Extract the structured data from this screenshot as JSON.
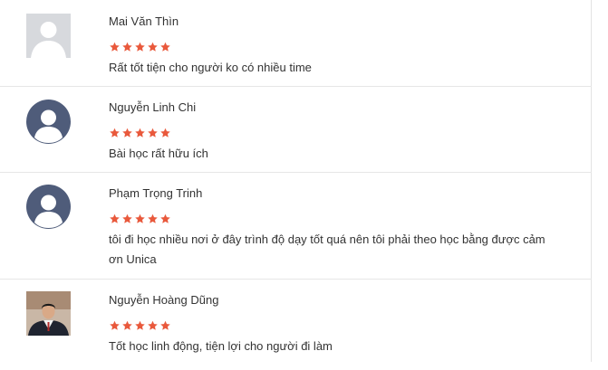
{
  "accent_star_color": "#e9593c",
  "reviews": [
    {
      "name": "Mai Văn Thìn",
      "rating": 5,
      "comment": "Rất tốt tiện cho người ko có nhiều time",
      "avatar": "default-silhouette-gray"
    },
    {
      "name": "Nguyễn Linh Chi",
      "rating": 5,
      "comment": "Bài học rất hữu ích",
      "avatar": "default-silhouette-blue"
    },
    {
      "name": "Phạm Trọng Trinh",
      "rating": 5,
      "comment": "tôi đi học nhiều nơi ở đây trình độ dạy tốt quá nên tôi phải theo học bằng được cảm ơn Unica",
      "avatar": "default-silhouette-blue"
    },
    {
      "name": "Nguyễn Hoàng Dũng",
      "rating": 5,
      "comment": "Tốt học linh động, tiện lợi cho người đi làm",
      "avatar": "user-photo"
    }
  ]
}
